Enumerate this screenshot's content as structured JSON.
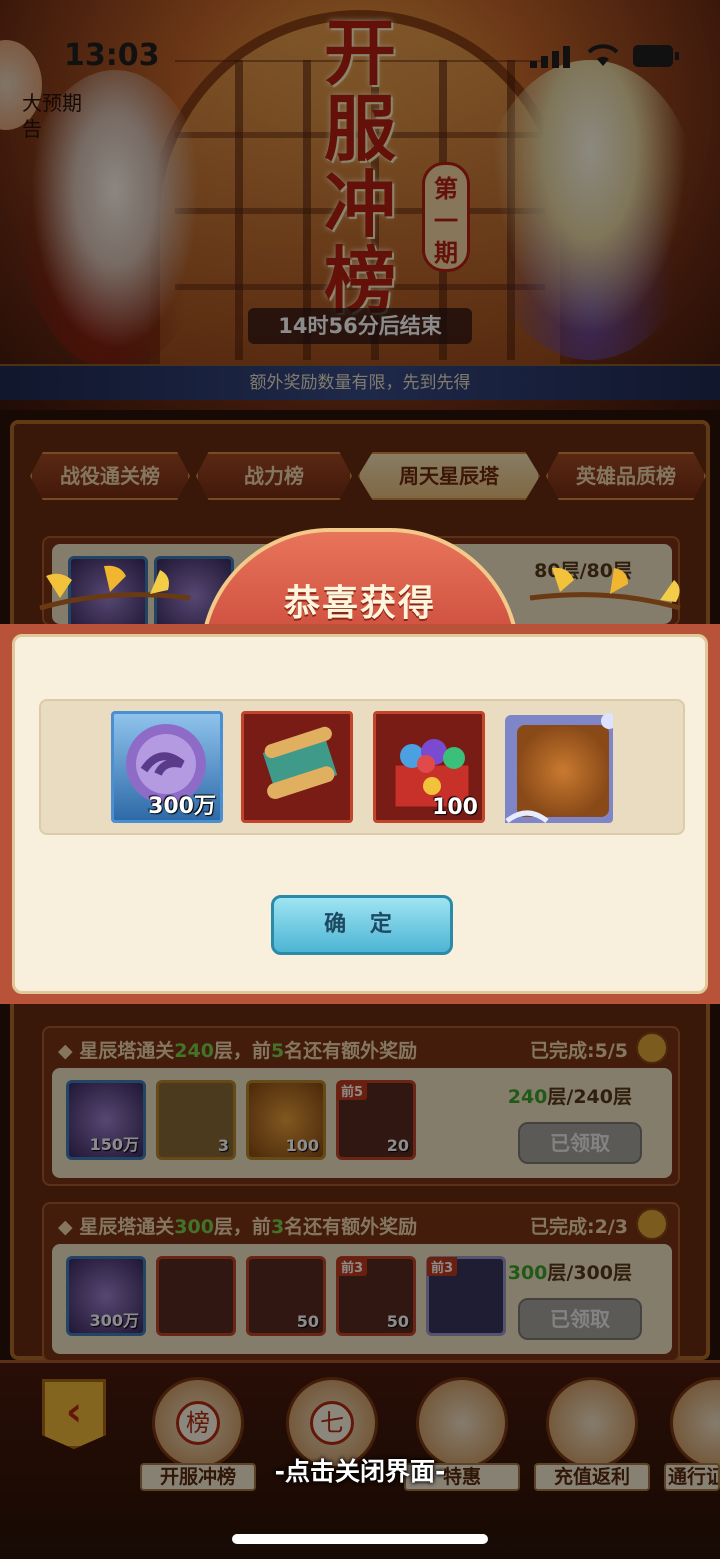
{
  "status_bar": {
    "time": "13:03"
  },
  "banner": {
    "ad_label": "大预期告",
    "title": "开服冲榜",
    "period": "第一期",
    "countdown": "14时56分后结束",
    "notice": "额外奖励数量有限，先到先得"
  },
  "tabs": [
    {
      "label": "战役通关榜",
      "active": false
    },
    {
      "label": "战力榜",
      "active": false
    },
    {
      "label": "周天星辰塔",
      "active": true
    },
    {
      "label": "英雄品质榜",
      "active": false
    }
  ],
  "background_tasks": [
    {
      "title_prefix": "星辰塔通关",
      "title_floor": "240",
      "title_mid": "层，前",
      "title_rank": "5",
      "title_suffix": "名还有额外奖励",
      "progress": "已完成:5/5",
      "floor_current": "240",
      "floor_total": "层/240层",
      "button": "已领取",
      "items": [
        {
          "icon": "star-orb-icon",
          "count": "150万",
          "tag": ""
        },
        {
          "icon": "scroll-icon",
          "count": "3",
          "tag": ""
        },
        {
          "icon": "coin-icon",
          "count": "100",
          "tag": ""
        },
        {
          "icon": "gem-chest-icon",
          "count": "20",
          "tag": "前5"
        }
      ]
    },
    {
      "title_prefix": "星辰塔通关",
      "title_floor": "300",
      "title_mid": "层，前",
      "title_rank": "3",
      "title_suffix": "名还有额外奖励",
      "progress": "已完成:2/3",
      "floor_current": "300",
      "floor_total": "层/300层",
      "button": "已领取",
      "items": [
        {
          "icon": "star-orb-icon",
          "count": "300万",
          "tag": ""
        },
        {
          "icon": "scroll-icon",
          "count": "",
          "tag": ""
        },
        {
          "icon": "gem-chest-icon",
          "count": "50",
          "tag": ""
        },
        {
          "icon": "gem-chest-icon",
          "count": "50",
          "tag": "前3"
        },
        {
          "icon": "avatar-frame-icon",
          "count": "",
          "tag": "前3"
        }
      ]
    }
  ],
  "top_task_floor": "80层/80层",
  "popup": {
    "title": "恭喜获得",
    "rewards": [
      {
        "icon": "star-orb-icon",
        "count": "300万"
      },
      {
        "icon": "scroll-icon",
        "count": ""
      },
      {
        "icon": "gem-chest-icon",
        "count": "100"
      },
      {
        "icon": "avatar-frame-icon",
        "count": ""
      }
    ],
    "confirm": "确 定"
  },
  "bottom_nav": {
    "items": [
      {
        "label": "开服冲榜",
        "glyph": "榜"
      },
      {
        "label": "",
        "glyph": "七"
      },
      {
        "label": "特惠",
        "glyph": ""
      },
      {
        "label": "充值返利",
        "glyph": ""
      },
      {
        "label": "通行证",
        "glyph": ""
      }
    ],
    "close_hint": "-点击关闭界面-"
  }
}
